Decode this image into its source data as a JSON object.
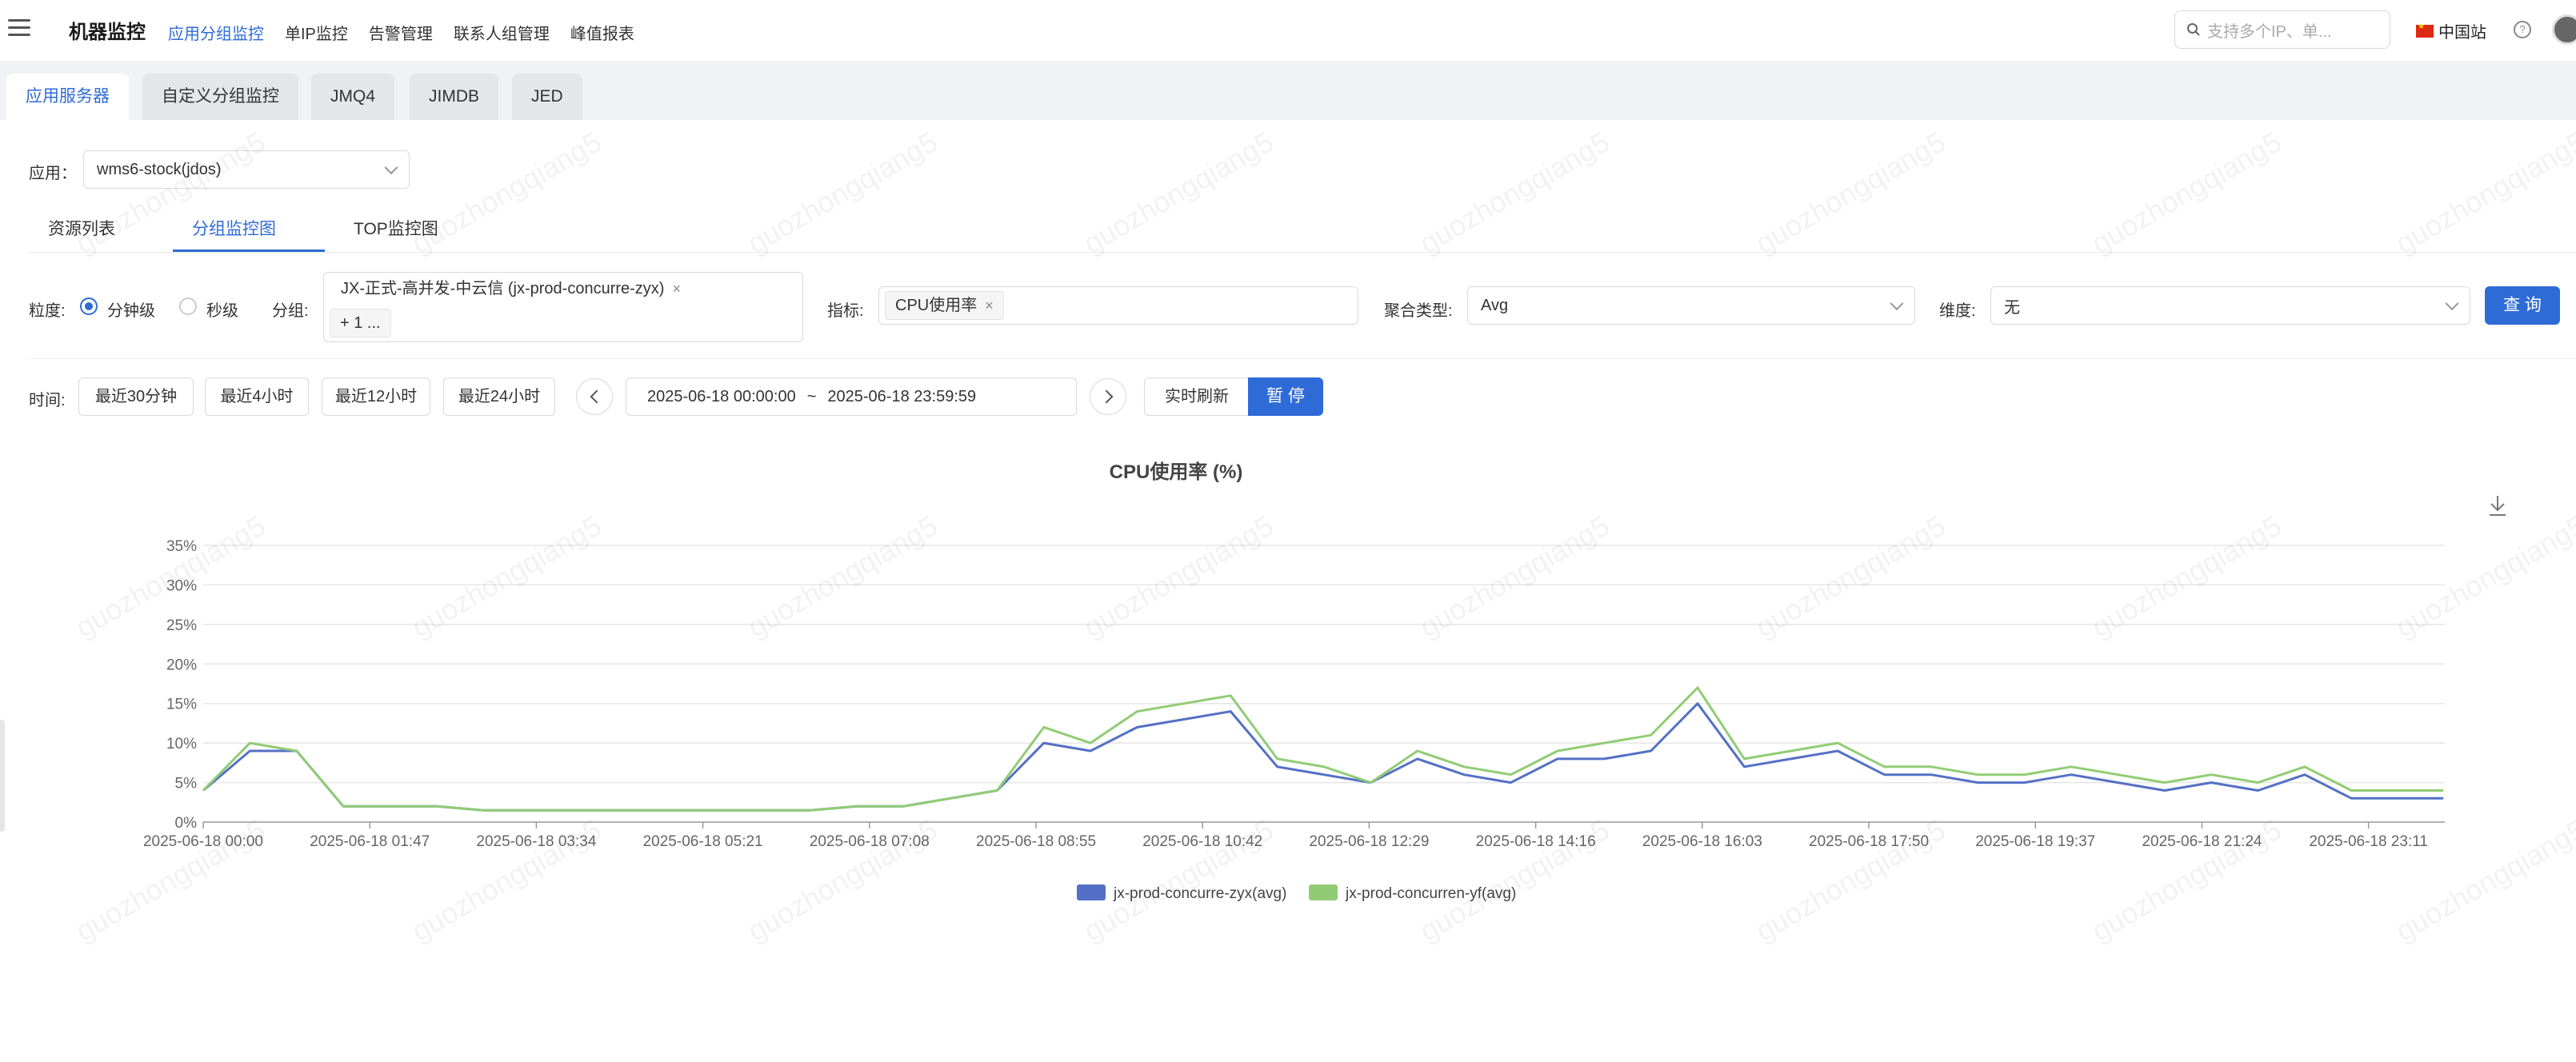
{
  "header": {
    "brand": "机器监控",
    "nav": [
      "应用分组监控",
      "单IP监控",
      "告警管理",
      "联系人组管理",
      "峰值报表"
    ],
    "active_nav": "应用分组监控",
    "search_placeholder": "支持多个IP、单...",
    "region": "中国站",
    "help": "?"
  },
  "service_tabs": [
    "应用服务器",
    "自定义分组监控",
    "JMQ4",
    "JIMDB",
    "JED"
  ],
  "app": {
    "label": "应用：",
    "value": "wms6-stock(jdos)"
  },
  "sub_tabs": [
    "资源列表",
    "分组监控图",
    "TOP监控图"
  ],
  "filters": {
    "granularity_label": "粒度:",
    "granularity_options": [
      "分钟级",
      "秒级"
    ],
    "group_label": "分组:",
    "group_tag": "JX-正式-高并发-中云信 (jx-prod-concurre-zyx)",
    "group_more": "+ 1 ...",
    "metric_label": "指标:",
    "metric_tag": "CPU使用率",
    "agg_label": "聚合类型:",
    "agg_value": "Avg",
    "dim_label": "维度:",
    "dim_value": "无",
    "query_button": "查 询"
  },
  "time": {
    "label": "时间:",
    "quick": [
      "最近30分钟",
      "最近4小时",
      "最近12小时",
      "最近24小时"
    ],
    "range_start": "2025-06-18 00:00:00",
    "range_sep": "~",
    "range_end": "2025-06-18 23:59:59",
    "realtime": "实时刷新",
    "pause": "暂 停"
  },
  "watermark": "guozhongqiang5",
  "chart_data": {
    "type": "line",
    "title": "CPU使用率 (%)",
    "ylim": [
      0,
      35
    ],
    "yticks": [
      "0%",
      "5%",
      "10%",
      "15%",
      "20%",
      "25%",
      "30%",
      "35%"
    ],
    "x_tick_labels": [
      "2025-06-18 00:00",
      "2025-06-18 01:47",
      "2025-06-18 03:34",
      "2025-06-18 05:21",
      "2025-06-18 07:08",
      "2025-06-18 08:55",
      "2025-06-18 10:42",
      "2025-06-18 12:29",
      "2025-06-18 14:16",
      "2025-06-18 16:03",
      "2025-06-18 17:50",
      "2025-06-18 19:37",
      "2025-06-18 21:24",
      "2025-06-18 23:11"
    ],
    "x": [
      "00:00",
      "00:30",
      "01:00",
      "01:30",
      "02:00",
      "02:30",
      "03:00",
      "03:30",
      "04:00",
      "04:30",
      "05:00",
      "05:30",
      "06:00",
      "06:30",
      "07:00",
      "07:30",
      "08:00",
      "08:30",
      "09:00",
      "09:30",
      "10:00",
      "10:30",
      "11:00",
      "11:30",
      "12:00",
      "12:30",
      "13:00",
      "13:30",
      "14:00",
      "14:30",
      "15:00",
      "15:30",
      "16:00",
      "16:30",
      "17:00",
      "17:30",
      "18:00",
      "18:30",
      "19:00",
      "19:30",
      "20:00",
      "20:30",
      "21:00",
      "21:30",
      "22:00",
      "22:30",
      "23:00",
      "23:30",
      "23:59"
    ],
    "series": [
      {
        "name": "jx-prod-concurre-zyx(avg)",
        "color": "#5470c6",
        "values": [
          4,
          9,
          9,
          2,
          2,
          2,
          1.5,
          1.5,
          1.5,
          1.5,
          1.5,
          1.5,
          1.5,
          1.5,
          2,
          2,
          3,
          4,
          10,
          9,
          12,
          13,
          14,
          7,
          6,
          5,
          8,
          6,
          5,
          8,
          8,
          9,
          15,
          7,
          8,
          9,
          6,
          6,
          5,
          5,
          6,
          5,
          4,
          5,
          4,
          6,
          3,
          3,
          3
        ]
      },
      {
        "name": "jx-prod-concurren-yf(avg)",
        "color": "#91cc75",
        "values": [
          4,
          10,
          9,
          2,
          2,
          2,
          1.5,
          1.5,
          1.5,
          1.5,
          1.5,
          1.5,
          1.5,
          1.5,
          2,
          2,
          3,
          4,
          12,
          10,
          14,
          15,
          16,
          8,
          7,
          5,
          9,
          7,
          6,
          9,
          10,
          11,
          17,
          8,
          9,
          10,
          7,
          7,
          6,
          6,
          7,
          6,
          5,
          6,
          5,
          7,
          4,
          4,
          4
        ]
      }
    ]
  }
}
